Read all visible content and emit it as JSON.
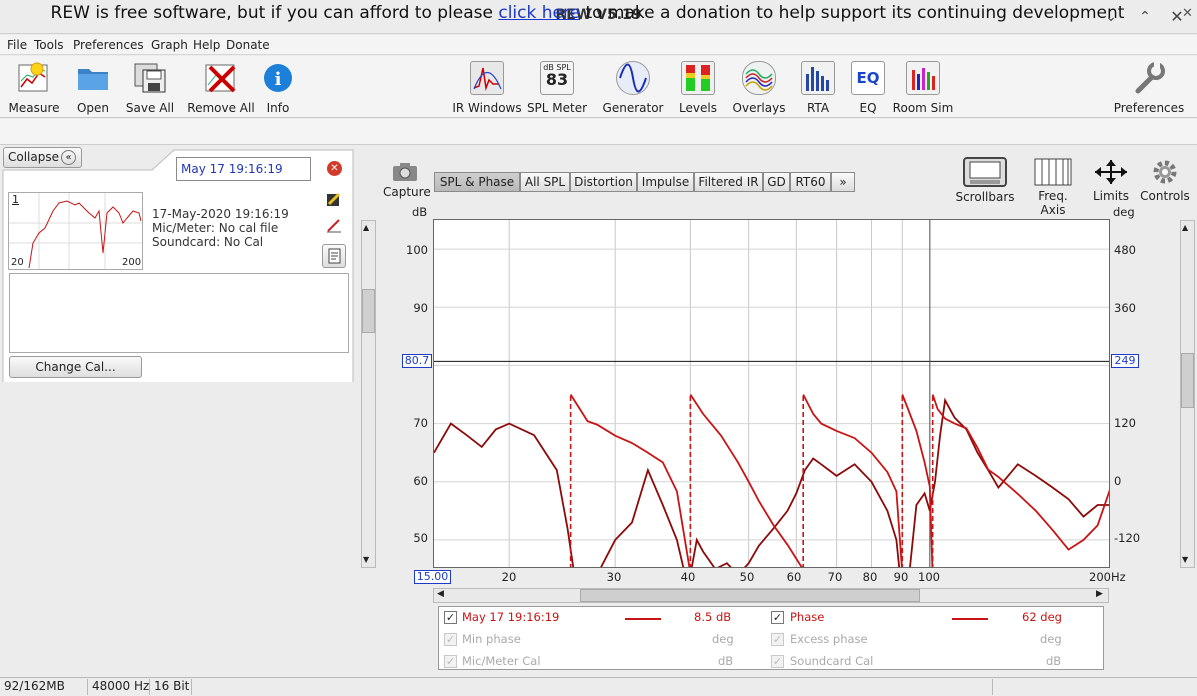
{
  "window": {
    "title": "REW V5.19"
  },
  "menu": [
    "File",
    "Tools",
    "Preferences",
    "Graph",
    "Help",
    "Donate"
  ],
  "toolbar": {
    "measure": "Measure",
    "open": "Open",
    "save_all": "Save All",
    "remove_all": "Remove All",
    "info": "Info",
    "ir_windows": "IR Windows",
    "spl_meter": "SPL Meter",
    "spl_meter_unit": "dB SPL",
    "spl_meter_value": "83",
    "generator": "Generator",
    "levels": "Levels",
    "overlays": "Overlays",
    "rta": "RTA",
    "eq": "EQ",
    "eq_badge": "EQ",
    "room_sim": "Room Sim",
    "preferences": "Preferences"
  },
  "banner": {
    "pre": "REW is free software, but if you can afford to please ",
    "link": "click here",
    "post": " to make a donation to help support its continuing development"
  },
  "left": {
    "collapse": "Collapse",
    "measurement_name": "May 17 19:16:19",
    "thumb_index": "1",
    "thumb_x_min": "20",
    "thumb_x_max": "200",
    "info_date": "17-May-2020 19:16:19",
    "info_mic": "Mic/Meter: No cal file",
    "info_soundcard": "Soundcard: No Cal",
    "change_cal": "Change Cal..."
  },
  "graph_tabs": [
    "SPL & Phase",
    "All SPL",
    "Distortion",
    "Impulse",
    "Filtered IR",
    "GD",
    "RT60",
    "»"
  ],
  "graph_toolbar": {
    "capture": "Capture",
    "scrollbars": "Scrollbars",
    "freq_axis": "Freq. Axis",
    "limits": "Limits",
    "controls": "Controls"
  },
  "axes": {
    "left_unit": "dB",
    "right_unit": "deg",
    "left_ticks": [
      "100",
      "90",
      "70",
      "60",
      "50"
    ],
    "right_ticks": [
      "480",
      "360",
      "120",
      "0",
      "-120"
    ],
    "x_ticks": [
      "20",
      "30",
      "40",
      "50",
      "60",
      "70",
      "80",
      "90",
      "100"
    ],
    "x_min_box": "15.00",
    "x_max": "200Hz",
    "cursor_left": "80.7",
    "cursor_right": "249"
  },
  "chart_data": {
    "type": "line",
    "x_scale": "log",
    "xlim": [
      15,
      200
    ],
    "ylim_left": [
      45,
      105
    ],
    "ylim_right": [
      -180,
      540
    ],
    "cursor_db": 80.7,
    "series": [
      {
        "name": "May 17 19:16:19",
        "axis": "left",
        "color": "#c81414",
        "x": [
          15,
          16,
          17,
          18,
          19,
          20,
          22,
          24,
          25,
          26,
          27,
          28,
          30,
          32,
          34,
          36,
          38,
          39,
          40,
          41,
          42,
          44,
          46,
          48,
          50,
          52,
          55,
          58,
          60,
          62,
          64,
          66,
          68,
          70,
          75,
          80,
          85,
          88,
          90,
          91,
          92,
          95,
          98,
          100,
          102,
          104,
          106,
          110,
          115,
          120,
          125,
          130,
          140,
          150,
          160,
          170,
          180,
          190,
          200
        ],
        "y": [
          65,
          70,
          68,
          66,
          69,
          70,
          68,
          62,
          52,
          40,
          38,
          44,
          50,
          53,
          62,
          56,
          50,
          45,
          44,
          50,
          48,
          45,
          46,
          44,
          46,
          49,
          52,
          55,
          58,
          62,
          64,
          63,
          62,
          61,
          63,
          60,
          55,
          50,
          40,
          25,
          42,
          56,
          58,
          55,
          60,
          68,
          74,
          71,
          69,
          65,
          62,
          59,
          63,
          61,
          59,
          57,
          54,
          56,
          56
        ]
      },
      {
        "name": "Phase",
        "axis": "right",
        "color": "#c81414",
        "x": [
          25.2,
          25.3,
          27,
          28,
          30,
          32,
          34,
          36,
          38,
          39.9,
          40,
          42,
          45,
          48,
          50,
          52,
          55,
          58,
          61.5,
          61.6,
          64,
          66,
          70,
          75,
          80,
          85,
          88,
          89.9,
          90,
          92,
          95,
          98,
          100,
          101,
          101.1,
          103,
          106,
          110,
          115,
          120,
          125,
          130,
          140,
          150,
          160,
          170,
          180,
          190,
          200
        ],
        "y": [
          -180,
          180,
          125,
          118,
          95,
          80,
          60,
          40,
          -20,
          -180,
          180,
          140,
          95,
          40,
          0,
          -40,
          -90,
          -130,
          -180,
          180,
          140,
          120,
          105,
          90,
          60,
          20,
          -20,
          -180,
          180,
          150,
          105,
          40,
          -10,
          -180,
          180,
          150,
          130,
          120,
          110,
          70,
          25,
          10,
          -25,
          -60,
          -100,
          -140,
          -120,
          -90,
          -10
        ]
      }
    ]
  },
  "legend": {
    "row1_name": "May 17 19:16:19",
    "row1_value": "8.5 dB",
    "row1_phase": "Phase",
    "row1_phase_value": "62 deg",
    "row2_a": "Min phase",
    "row2_a_unit": "deg",
    "row2_b": "Excess phase",
    "row2_b_unit": "deg",
    "row3_a": "Mic/Meter Cal",
    "row3_a_unit": "dB",
    "row3_b": "Soundcard Cal",
    "row3_b_unit": "dB"
  },
  "status": {
    "memory": "92/162MB",
    "rate": "48000 Hz",
    "bits": "16 Bit"
  }
}
